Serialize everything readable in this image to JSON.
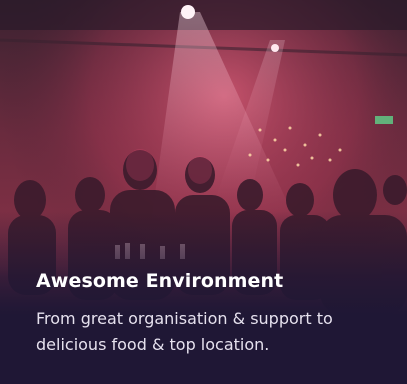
{
  "card": {
    "image_alt": "crowd at an evening event under pink stage lights",
    "title": "Awesome Environment",
    "description": "From great organisation & support to delicious food & top location."
  },
  "colors": {
    "background": "#1f1735",
    "title": "#ffffff",
    "description": "#e6e1ee",
    "light_tint": "#d8486e"
  }
}
